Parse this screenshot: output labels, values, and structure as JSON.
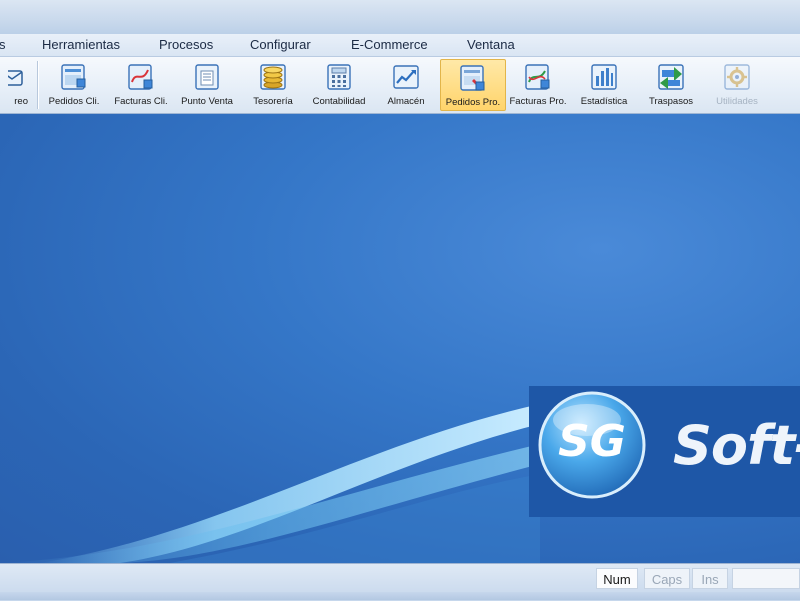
{
  "menubar": {
    "items": [
      "s",
      "Herramientas",
      "Procesos",
      "Configurar",
      "E-Commerce",
      "Ventana"
    ]
  },
  "toolbar": {
    "items": [
      {
        "label": "reo",
        "icon": "mail-icon",
        "state": "normal"
      },
      {
        "label": "Pedidos Cli.",
        "icon": "customer-orders-icon",
        "state": "normal"
      },
      {
        "label": "Facturas Cli.",
        "icon": "customer-invoices-icon",
        "state": "normal"
      },
      {
        "label": "Punto Venta",
        "icon": "point-of-sale-icon",
        "state": "normal"
      },
      {
        "label": "Tesorería",
        "icon": "treasury-coins-icon",
        "state": "normal"
      },
      {
        "label": "Contabilidad",
        "icon": "accounting-calculator-icon",
        "state": "normal"
      },
      {
        "label": "Almacén",
        "icon": "warehouse-chart-icon",
        "state": "normal"
      },
      {
        "label": "Pedidos Pro.",
        "icon": "supplier-orders-icon",
        "state": "active"
      },
      {
        "label": "Facturas Pro.",
        "icon": "supplier-invoices-icon",
        "state": "normal"
      },
      {
        "label": "Estadística",
        "icon": "statistics-bars-icon",
        "state": "normal"
      },
      {
        "label": "Traspasos",
        "icon": "transfers-icon",
        "state": "normal"
      },
      {
        "label": "Utilidades",
        "icon": "utilities-gear-icon",
        "state": "disabled"
      }
    ]
  },
  "logo": {
    "monogram": "SG",
    "text": "Soft-"
  },
  "statusbar": {
    "num": "Num",
    "caps": "Caps",
    "ins": "Ins"
  },
  "colors": {
    "desktop": "#2f6fc0",
    "logo_panel": "#1e57a7",
    "active_button": "#ffd46b"
  }
}
